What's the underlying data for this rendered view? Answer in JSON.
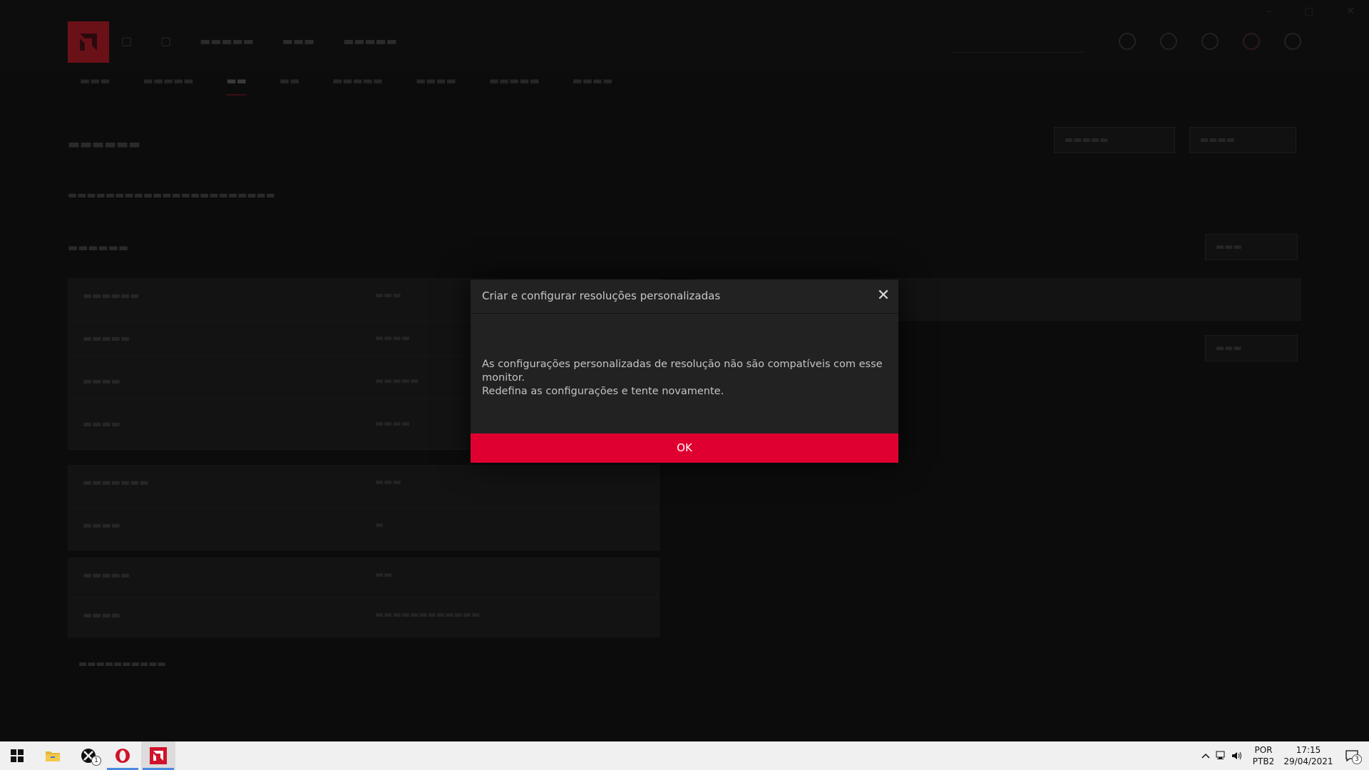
{
  "dialog": {
    "title": "Criar e configurar resoluções personalizadas",
    "message_line1": "As configurações personalizadas de resolução não são compatíveis com esse monitor.",
    "message_line2": "Redefina as configurações e tente novamente.",
    "ok_label": "OK",
    "accent_color": "#df0030"
  },
  "taskbar": {
    "apps": [
      {
        "name": "windows-start",
        "icon": "windows-logo-icon"
      },
      {
        "name": "file-explorer",
        "icon": "folder-icon"
      },
      {
        "name": "xbox",
        "icon": "xbox-icon",
        "badge": "1"
      },
      {
        "name": "opera",
        "icon": "opera-icon"
      },
      {
        "name": "amd-radeon",
        "icon": "amd-icon"
      }
    ],
    "language_top": "POR",
    "language_bottom": "PTB2",
    "time": "17:15",
    "date": "29/04/2021",
    "notification_count": "3"
  }
}
